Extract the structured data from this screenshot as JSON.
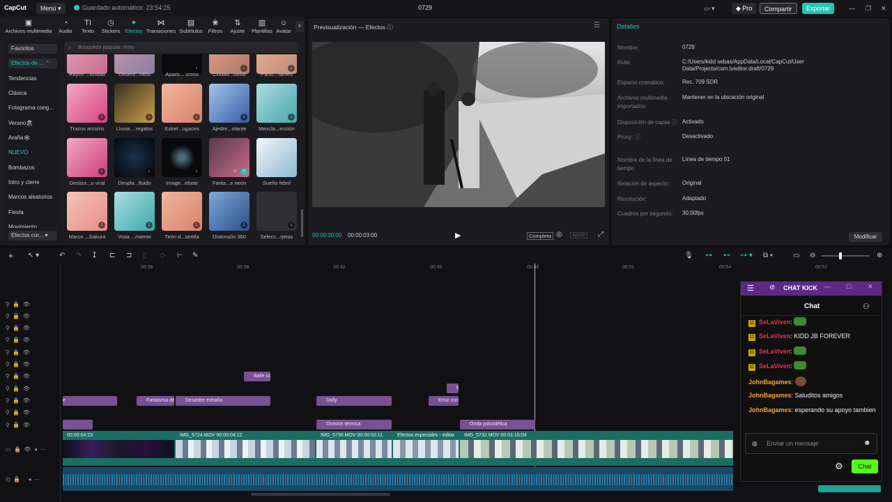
{
  "app": {
    "logo": "CapCut",
    "menu": "Menú",
    "autosave": "Guardado automático: 23:54:25",
    "project": "0729",
    "pro": "Pro",
    "share": "Compartir",
    "export": "Exportar"
  },
  "tools": [
    {
      "icon": "media-icon",
      "label": "Archivos multimedia"
    },
    {
      "icon": "audio-icon",
      "label": "Audio"
    },
    {
      "icon": "text-icon",
      "label": "Texto"
    },
    {
      "icon": "stickers-icon",
      "label": "Stickers"
    },
    {
      "icon": "effects-icon",
      "label": "Efectos"
    },
    {
      "icon": "transitions-icon",
      "label": "Transiciones"
    },
    {
      "icon": "subtitles-icon",
      "label": "Subtítulos"
    },
    {
      "icon": "filters-icon",
      "label": "Filtros"
    },
    {
      "icon": "adjust-icon",
      "label": "Ajuste"
    },
    {
      "icon": "templates-icon",
      "label": "Plantillas"
    },
    {
      "icon": "avatar-icon",
      "label": "Avatar"
    }
  ],
  "sidebar": [
    "Favoritos",
    "Efectos de ...",
    "Tendencias",
    "Clásica",
    "Fotograma cong...",
    "Verano🏖",
    "Araña🕸",
    "NUEVO",
    "Bombazos",
    "Intro y cierre",
    "Marcos aleatorios",
    "Fiesta",
    "Movimiento",
    "Efectos cor..."
  ],
  "search_placeholder": "Búsqueda popular: Reto",
  "effects": [
    {
      "label": "Rayos ...ocidad"
    },
    {
      "label": "Desenf...rillos"
    },
    {
      "label": "Aparic... icono"
    },
    {
      "label": "Ciudad...stelar"
    },
    {
      "label": "Partic...tantes"
    },
    {
      "label": "Trazos arcoíris"
    },
    {
      "label": "Lluvia ...regalos"
    },
    {
      "label": "Estrel...ugaces"
    },
    {
      "label": "Ajedre...otante"
    },
    {
      "label": "Mezcla...ección"
    },
    {
      "label": "Desliza...o viral"
    },
    {
      "label": "Despla...fluido"
    },
    {
      "label": "Image...ebote"
    },
    {
      "label": "Fanta...e neón"
    },
    {
      "label": "Sueño febril"
    },
    {
      "label": "Marco ...Sakura"
    },
    {
      "label": "Vista ...miento"
    },
    {
      "label": "Tirón d...strella"
    },
    {
      "label": "Distorsión 360"
    },
    {
      "label": "Selecc...rjetas"
    }
  ],
  "preview": {
    "title": "Previsualización — Efectos",
    "time_current": "00:00:00:00",
    "time_total": "00:00:03:00",
    "complete": "Completa",
    "zoom": "Ajuste"
  },
  "details": {
    "title": "Detalles",
    "modify": "Modificar",
    "rows": [
      {
        "label": "Nombre:",
        "value": "0729"
      },
      {
        "label": "Ruta:",
        "value": "C:/Users/kidd sebas/AppData/Local/CapCut/User Data/Projects/com.lveditor.draft/0729"
      },
      {
        "label": "Espacio cromático:",
        "value": "Rec. 709 SDR"
      },
      {
        "label": "Archivos multimedia importados:",
        "value": "Mantener en la ubicación original"
      },
      {
        "label": "Disposición de capas",
        "value": "Activado"
      },
      {
        "label": "Proxy:",
        "value": "Desactivado"
      },
      {
        "label": "Nombre de la línea de tiempo",
        "value": "Línea de tiempo 01"
      },
      {
        "label": "Relación de aspecto:",
        "value": "Original"
      },
      {
        "label": "Resolución:",
        "value": "Adaptado"
      },
      {
        "label": "Cuadros por segundo:",
        "value": "30.00fps"
      }
    ]
  },
  "ruler": [
    "00:36",
    "00:39",
    "00:42",
    "00:45",
    "00:48",
    "00:51",
    "00:54",
    "00:57"
  ],
  "clips": [
    {
      "label": "Baile co"
    },
    {
      "label": "E"
    },
    {
      "label": "e"
    },
    {
      "label": "Fantasma de"
    },
    {
      "label": "Desastre extraño"
    },
    {
      "label": "Dolly"
    },
    {
      "label": "Error con"
    },
    {
      "label": "División térmica"
    },
    {
      "label": "Onda psicodélica"
    }
  ],
  "video_clips": [
    {
      "label": "00:00:04:23"
    },
    {
      "label": "IMG_5724.MOV  00:00:04:12"
    },
    {
      "label": "IMG_5730.MOV  00:00:02:11"
    },
    {
      "label": "Efectos especiales - editar"
    },
    {
      "label": "IMG_5732.MOV  00:01:15:04"
    }
  ],
  "chat": {
    "title": "CHAT KICK",
    "tab": "Chat",
    "placeholder": "Enviar un mensaje",
    "send": "Chat",
    "messages": [
      {
        "badge": "11",
        "user": "SeLaViven",
        "text": ""
      },
      {
        "badge": "11",
        "user": "SeLaViven",
        "text": "KIDD JB FOREVER"
      },
      {
        "badge": "11",
        "user": "SeLaViven",
        "text": ""
      },
      {
        "badge": "11",
        "user": "SeLaViven",
        "text": ""
      },
      {
        "badge": "",
        "user": "JohnBagames",
        "text": ""
      },
      {
        "badge": "",
        "user": "JohnBagames",
        "text": "Saluditos amigos"
      },
      {
        "badge": "",
        "user": "JohnBagames",
        "text": "esperando su apoyo tambien"
      }
    ]
  }
}
